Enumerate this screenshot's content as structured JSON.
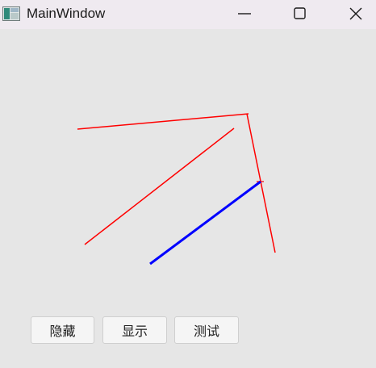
{
  "window": {
    "title": "MainWindow",
    "app_icon": "qt-app-icon"
  },
  "controls": {
    "minimize_icon": "minimize-icon",
    "maximize_icon": "maximize-icon",
    "close_icon": "close-icon"
  },
  "canvas": {
    "line_color": "#ff0000",
    "highlight_color": "#0000ff"
  },
  "buttons": {
    "hide": "隐藏",
    "show": "显示",
    "test": "测试"
  }
}
